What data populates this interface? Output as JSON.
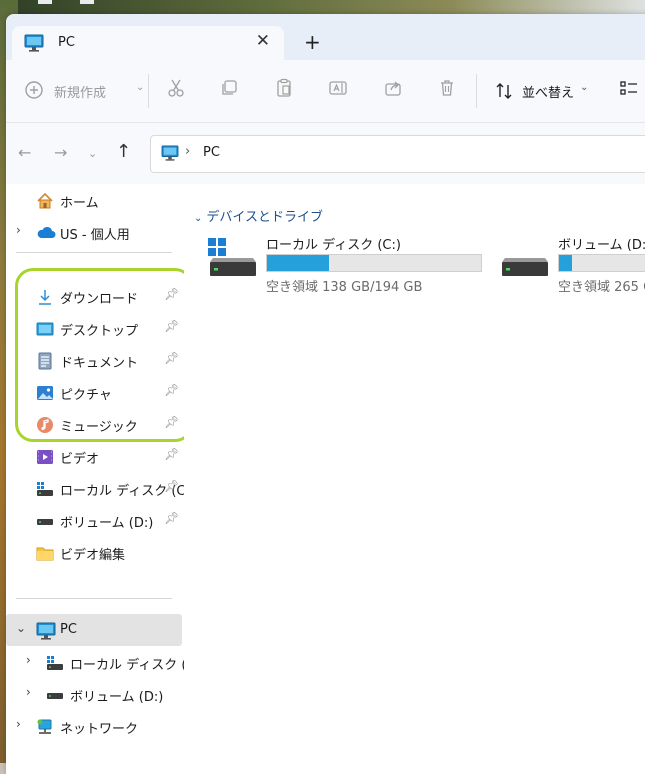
{
  "tab": {
    "title": "PC",
    "close": "✕",
    "new_tab": "+"
  },
  "toolbar": {
    "new_label": "新規作成",
    "sort_label": "並べ替え"
  },
  "address": {
    "separator": "›",
    "text": "PC"
  },
  "sidebar": {
    "items": [
      {
        "label": "ホーム",
        "icon": "home-icon"
      },
      {
        "label": "US - 個人用",
        "icon": "onedrive-cloud-icon"
      },
      {
        "label": "ダウンロード",
        "icon": "download-icon",
        "pinned": true
      },
      {
        "label": "デスクトップ",
        "icon": "desktop-icon",
        "pinned": true
      },
      {
        "label": "ドキュメント",
        "icon": "document-icon",
        "pinned": true
      },
      {
        "label": "ピクチャ",
        "icon": "pictures-icon",
        "pinned": true
      },
      {
        "label": "ミュージック",
        "icon": "music-icon",
        "pinned": true
      },
      {
        "label": "ビデオ",
        "icon": "video-icon",
        "pinned": true
      },
      {
        "label": "ローカル ディスク (C",
        "icon": "local-disk-icon",
        "pinned": true
      },
      {
        "label": "ボリューム (D:)",
        "icon": "drive-icon",
        "pinned": true
      },
      {
        "label": "ビデオ編集",
        "icon": "folder-icon"
      },
      {
        "label": "PC",
        "icon": "pc-icon"
      },
      {
        "label": "ローカル ディスク (C:)",
        "icon": "local-disk-icon"
      },
      {
        "label": "ボリューム (D:)",
        "icon": "drive-icon"
      },
      {
        "label": "ネットワーク",
        "icon": "network-icon"
      }
    ]
  },
  "content": {
    "group_header": "デバイスとドライブ",
    "drives": [
      {
        "name": "ローカル ディスク (C:)",
        "free_text": "空き領域 138 GB/194 GB",
        "used_fraction": 0.29
      },
      {
        "name": "ボリューム (D:)",
        "free_text": "空き領域 265 G",
        "used_fraction": 0.06
      }
    ]
  },
  "colors": {
    "accent": "#26a0da",
    "highlight": "#a8d42d"
  }
}
